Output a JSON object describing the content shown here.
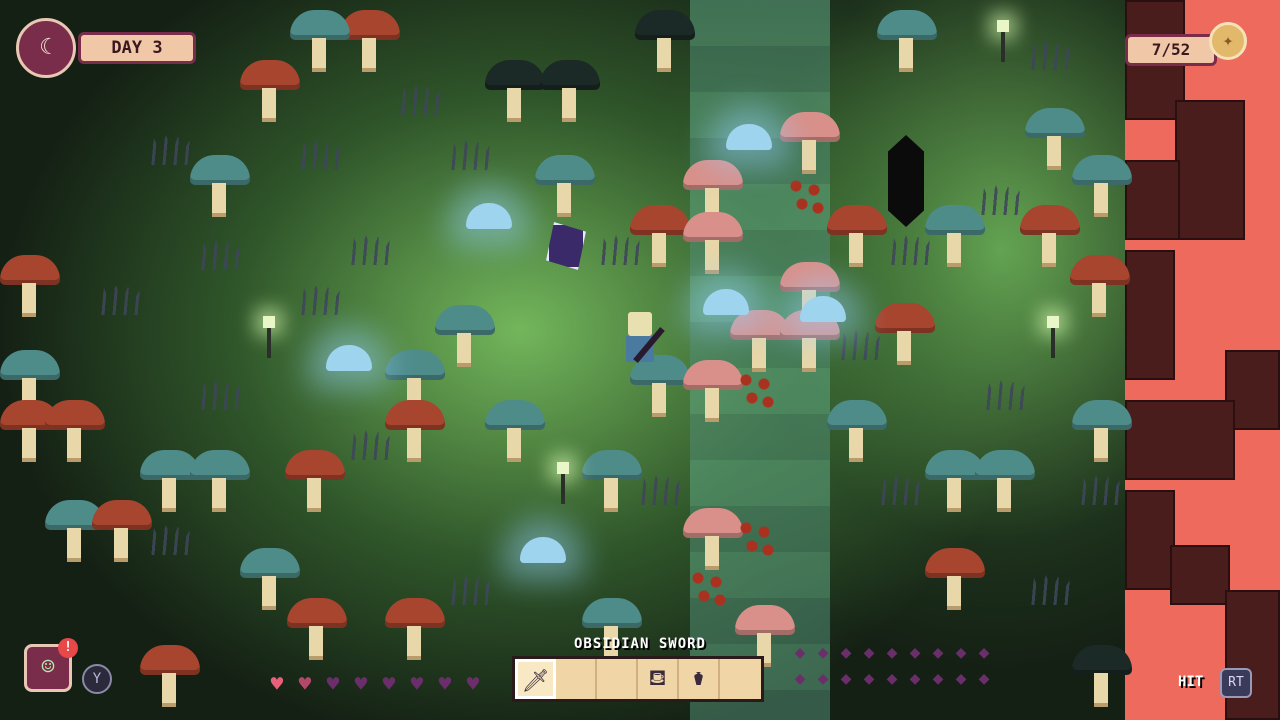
{
  "hud": {
    "day": {
      "label": "DAY 3",
      "icon": "moon-clock-icon"
    },
    "collection": {
      "count": "7/52",
      "icon": "medal-icon"
    },
    "journal": {
      "icon": "journal-icon",
      "alert": "!",
      "button": "Y"
    },
    "health": {
      "hearts_total": 8,
      "hearts_filled": 1.5,
      "full_color": "#e8607a",
      "empty_color": "#6a2f6a"
    },
    "hotbar": {
      "selected_item_name": "OBSIDIAN SWORD",
      "slots": [
        "sword-icon",
        "",
        "",
        "",
        "watering-can-icon",
        "lantern-icon"
      ]
    },
    "energy": {
      "drops_total": 18,
      "icon": "energy-drop-icon"
    },
    "action": {
      "label": "HIT",
      "button": "RT"
    }
  },
  "colors": {
    "lava": "#ee6a5c",
    "grass": "#5ea04a",
    "hud_plate": "#f0c8a8",
    "hud_border": "#7a2d4a"
  }
}
